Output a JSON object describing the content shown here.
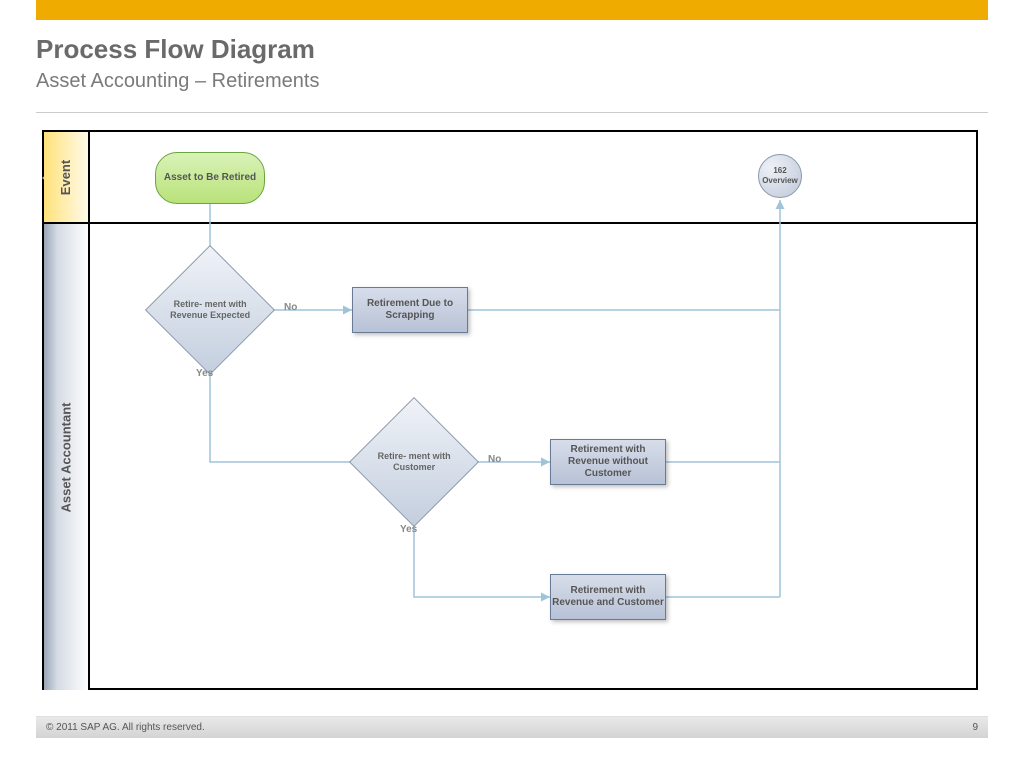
{
  "colors": {
    "accent": "#f0ab00",
    "connector": "#9fc4da"
  },
  "header": {
    "title": "Process Flow Diagram",
    "subtitle": "Asset Accounting – Retirements"
  },
  "swimlanes": {
    "event": "Event",
    "asset_accountant": "Asset Accountant"
  },
  "nodes": {
    "start": "Asset to Be Retired",
    "end": "162 Overview",
    "d1": "Retire-\nment\nwith\nRevenue\nExpected",
    "p_scrap": "Retirement Due to Scrapping",
    "d2": "Retire-\nment with\nCustomer",
    "p_nocust": "Retirement with Revenue without Customer",
    "p_cust": "Retirement with Revenue and Customer"
  },
  "labels": {
    "no": "No",
    "yes": "Yes"
  },
  "footer": {
    "copyright": "©  2011 SAP AG. All rights reserved.",
    "page": "9"
  }
}
